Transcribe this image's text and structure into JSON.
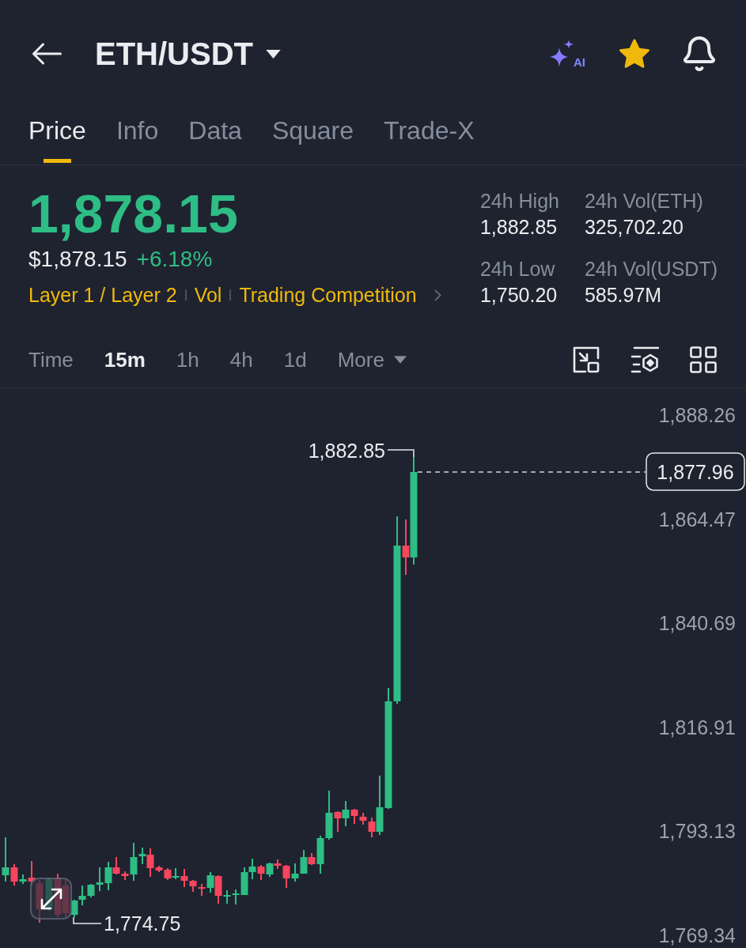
{
  "header": {
    "pair": "ETH/USDT",
    "ai_label": "AI",
    "favorited": true
  },
  "tabs": [
    {
      "label": "Price",
      "selected": true
    },
    {
      "label": "Info",
      "selected": false
    },
    {
      "label": "Data",
      "selected": false
    },
    {
      "label": "Square",
      "selected": false
    },
    {
      "label": "Trade-X",
      "selected": false
    }
  ],
  "ticker": {
    "last_price": "1,878.15",
    "fiat_price": "$1,878.15",
    "change": "+6.18%",
    "rising": true,
    "tags": [
      "Layer 1 / Layer 2",
      "Vol",
      "Trading Competition"
    ]
  },
  "stats": [
    {
      "label": "24h High",
      "value": "1,882.85"
    },
    {
      "label": "24h Vol(ETH)",
      "value": "325,702.20"
    },
    {
      "label": "24h Low",
      "value": "1,750.20"
    },
    {
      "label": "24h Vol(USDT)",
      "value": "585.97M"
    }
  ],
  "intervals": [
    {
      "label": "Time",
      "kind": "option",
      "selected": false
    },
    {
      "label": "15m",
      "kind": "option",
      "selected": true
    },
    {
      "label": "1h",
      "kind": "option",
      "selected": false
    },
    {
      "label": "4h",
      "kind": "option",
      "selected": false
    },
    {
      "label": "1d",
      "kind": "option",
      "selected": false
    },
    {
      "label": "More",
      "kind": "dropdown",
      "selected": false
    }
  ],
  "chart": {
    "price_axis": [
      "1,888.26",
      "1,864.47",
      "1,840.69",
      "1,816.91",
      "1,793.13",
      "1,769.34"
    ],
    "high_label": "1,882.85",
    "low_label": "1,774.75",
    "current_price": "1,877.96"
  }
}
